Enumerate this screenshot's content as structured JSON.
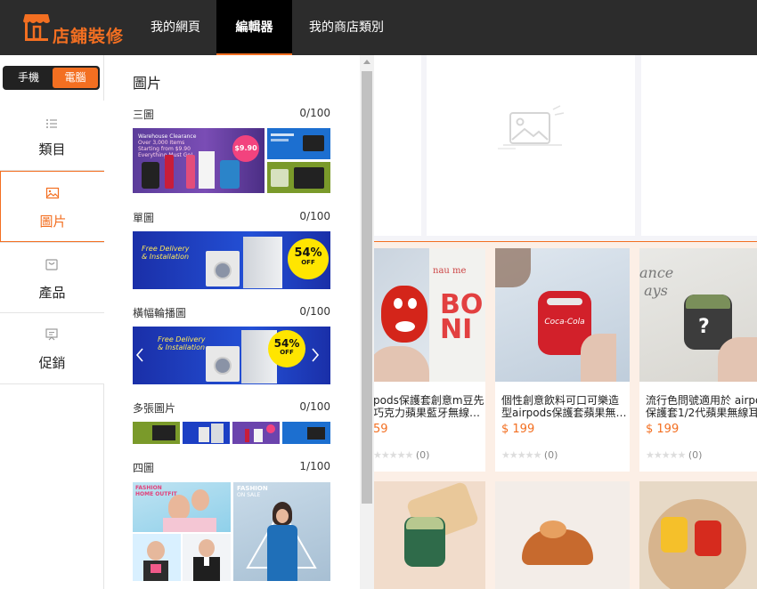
{
  "brand": {
    "logo_text": "店鋪裝修"
  },
  "nav": {
    "tabs": [
      {
        "label": "我的網頁"
      },
      {
        "label": "編輯器"
      },
      {
        "label": "我的商店類別"
      }
    ],
    "active_tab": "編輯器"
  },
  "device_toggle": {
    "mobile": "手機",
    "desktop": "電腦",
    "selected": "電腦"
  },
  "sidebar": {
    "items": [
      {
        "label": "類目",
        "icon": "list-icon"
      },
      {
        "label": "圖片",
        "icon": "image-icon"
      },
      {
        "label": "產品",
        "icon": "product-box-icon"
      },
      {
        "label": "促銷",
        "icon": "promotion-icon"
      }
    ],
    "active": "圖片"
  },
  "panel": {
    "title": "圖片",
    "sections": [
      {
        "label": "三圖",
        "count": "0/100",
        "banner_text": [
          "Warehouse Clearance",
          "Over 3,000 Items",
          "Starting from $9.90",
          "Everything Must Go!"
        ],
        "price_badge": "$9.90"
      },
      {
        "label": "單圖",
        "count": "0/100",
        "banner_text": [
          "Free Delivery",
          "& Installation"
        ],
        "badge": [
          "54%",
          "OFF"
        ]
      },
      {
        "label": "橫幅輪播圖",
        "count": "0/100",
        "banner_text": [
          "Free Delivery",
          "& Installation"
        ],
        "badge": [
          "54%",
          "OFF"
        ]
      },
      {
        "label": "多張圖片",
        "count": "0/100"
      },
      {
        "label": "四圖",
        "count": "1/100",
        "banner_text": [
          "FASHION",
          "HOME OUTFIT",
          "FASHION",
          "ON SALE"
        ]
      }
    ]
  },
  "products": [
    {
      "name_line1": "pods保護套創意m豆先",
      "name_line2": "巧克力蘋果藍牙無線…",
      "price": "59",
      "rating": "(0)"
    },
    {
      "name_line1": "個性創意飲料可口可樂造",
      "name_line2": "型airpods保護套蘋果無…",
      "price": "$ 199",
      "rating": "(0)"
    },
    {
      "name_line1": "流行色問號適用於 airpo",
      "name_line2": "保護套1/2代蘋果無線耳",
      "price": "$ 199",
      "rating": "(0)"
    }
  ],
  "colors": {
    "accent": "#f36f21",
    "topbar": "#2c2c2c",
    "blue_banner": "#1e3fc4"
  }
}
